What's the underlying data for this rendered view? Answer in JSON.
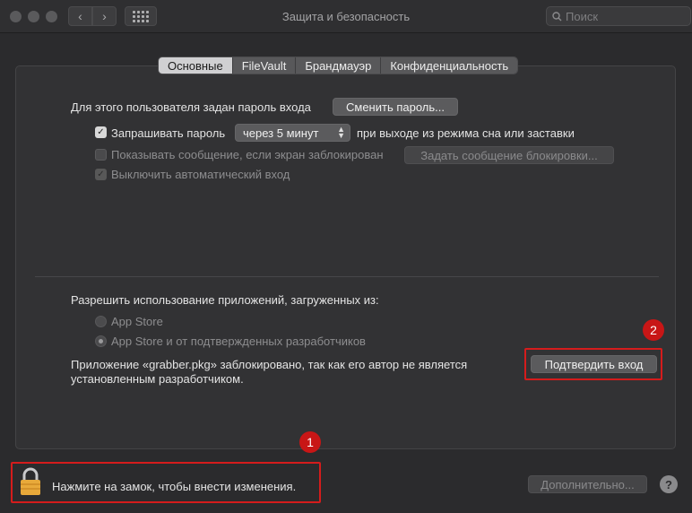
{
  "window": {
    "title": "Защита и безопасность",
    "search_placeholder": "Поиск"
  },
  "tabs": [
    {
      "label": "Основные",
      "active": true
    },
    {
      "label": "FileVault",
      "active": false
    },
    {
      "label": "Брандмауэр",
      "active": false
    },
    {
      "label": "Конфиденциальность",
      "active": false
    }
  ],
  "general": {
    "password_label": "Для этого пользователя задан пароль входа",
    "change_password_button": "Сменить пароль...",
    "require_password": {
      "label": "Запрашивать пароль",
      "checked": true
    },
    "require_delay": "через 5 минут",
    "require_suffix": "при выходе из режима сна или заставки",
    "show_message": {
      "label": "Показывать сообщение, если экран заблокирован",
      "checked": false
    },
    "set_message_button": "Задать сообщение блокировки...",
    "disable_autologin": {
      "label": "Выключить автоматический вход",
      "checked": true
    }
  },
  "apps": {
    "heading": "Разрешить использование приложений, загруженных из:",
    "option_store": "App Store",
    "option_store_devs": "App Store и от подтвержденных разработчиков",
    "blocked_message_line1": "Приложение «grabber.pkg» заблокировано, так как его автор не является",
    "blocked_message_line2": "установленным разработчиком.",
    "confirm_button": "Подтвердить вход"
  },
  "footer": {
    "lock_text": "Нажмите на замок, чтобы внести изменения.",
    "advanced_button": "Дополнительно...",
    "help": "?"
  },
  "annotations": {
    "badge1": "1",
    "badge2": "2",
    "color": "#d51c1c"
  }
}
